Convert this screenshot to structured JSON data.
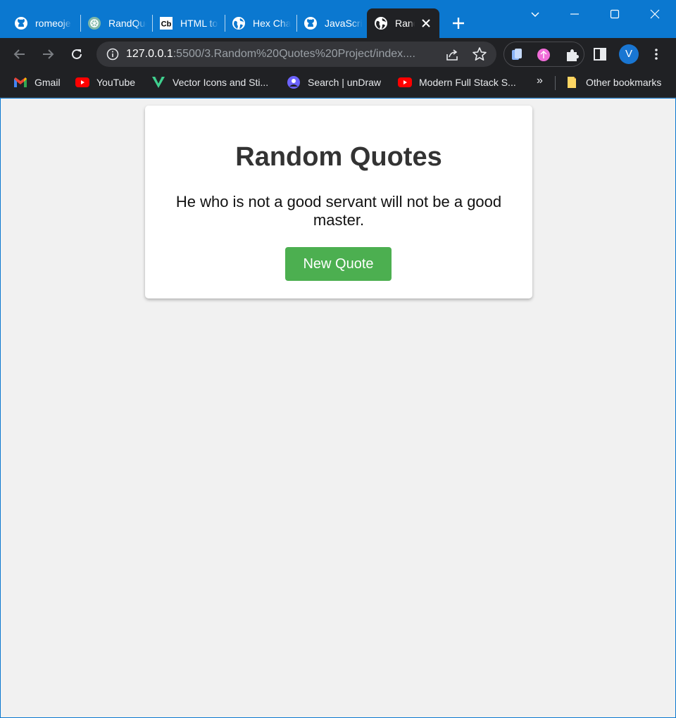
{
  "browser": {
    "tabs": [
      {
        "title": "romeojeremiah",
        "icon": "github-icon"
      },
      {
        "title": "RandQuotes",
        "icon": "chatgpt-icon"
      },
      {
        "title": "HTML to",
        "icon": "codebeautify-icon"
      },
      {
        "title": "Hex Chart",
        "icon": "globe-icon"
      },
      {
        "title": "JavaScript",
        "icon": "github-icon"
      },
      {
        "title": "Random Quotes",
        "icon": "globe-icon",
        "active": true
      }
    ],
    "url_host": "127.0.0.1",
    "url_rest": ":5500/3.Random%20Quotes%20Project/index....",
    "profile_initial": "V",
    "bookmarks": [
      {
        "label": "Gmail",
        "icon": "gmail-icon"
      },
      {
        "label": "YouTube",
        "icon": "youtube-icon"
      },
      {
        "label": "Vector Icons and Sti...",
        "icon": "vector-icon"
      },
      {
        "label": "Search | unDraw",
        "icon": "undraw-icon"
      },
      {
        "label": "Modern Full Stack S...",
        "icon": "youtube-icon"
      }
    ],
    "more_bookmarks": "»",
    "other_bookmarks": "Other bookmarks",
    "colors": {
      "titlebar": "#0b78d0",
      "toolbar": "#202124"
    }
  },
  "page": {
    "title": "Random Quotes",
    "quote": "He who is not a good servant will not be a good master.",
    "button_label": "New Quote",
    "colors": {
      "background": "#f1f1f1",
      "button": "#4caf50",
      "heading": "#333333"
    }
  }
}
